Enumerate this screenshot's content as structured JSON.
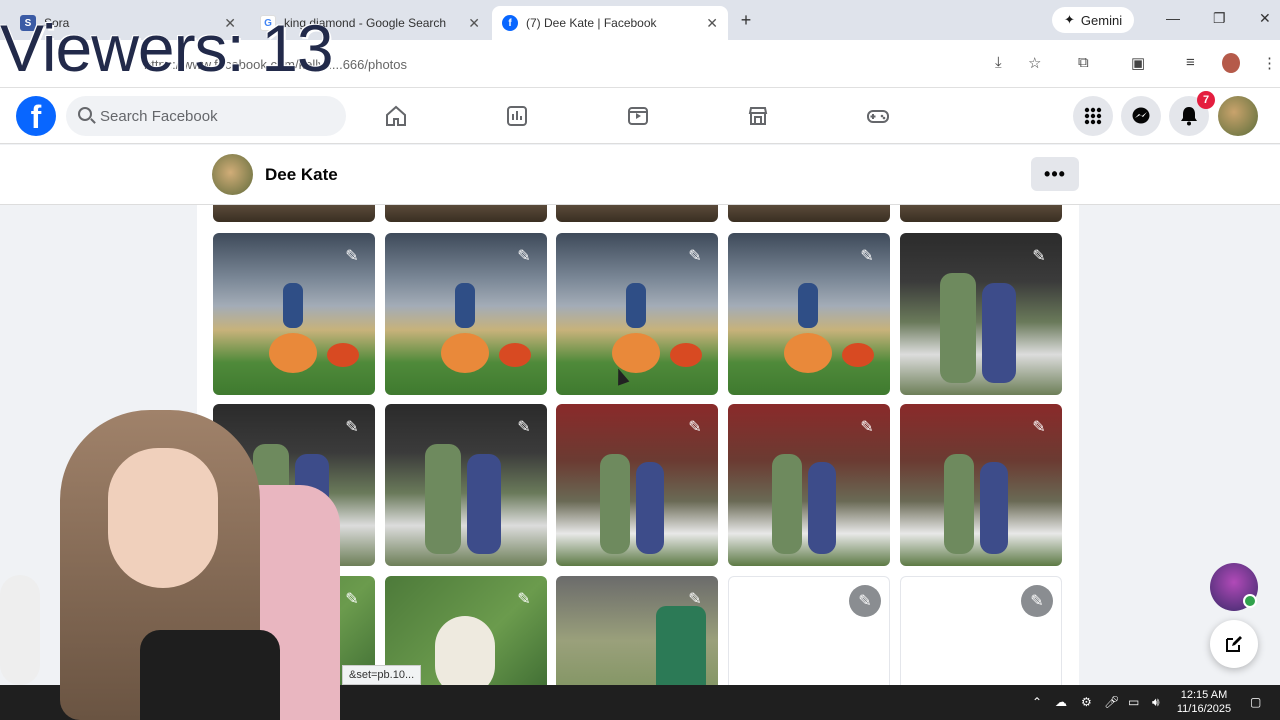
{
  "overlay": {
    "viewers": "Viewers: 13"
  },
  "browser": {
    "tabs": [
      {
        "title": "Sora",
        "active": false
      },
      {
        "title": "king diamond - Google Search",
        "active": false
      },
      {
        "title": "(7) Dee Kate | Facebook",
        "active": true
      }
    ],
    "new_tab": "+",
    "gemini_label": "Gemini",
    "url": "https://www.facebook.com/kellyn...666/photos",
    "status_url": "&set=pb.10..."
  },
  "facebook": {
    "logo": "f",
    "search_placeholder": "Search Facebook",
    "notification_count": "7",
    "profile_name": "Dee Kate",
    "more_label": "•••"
  },
  "taskbar": {
    "time": "12:15 AM",
    "date": "11/16/2025"
  },
  "colors": {
    "fb_blue": "#0866ff",
    "badge_red": "#e41e3f",
    "online_green": "#31a24c"
  }
}
